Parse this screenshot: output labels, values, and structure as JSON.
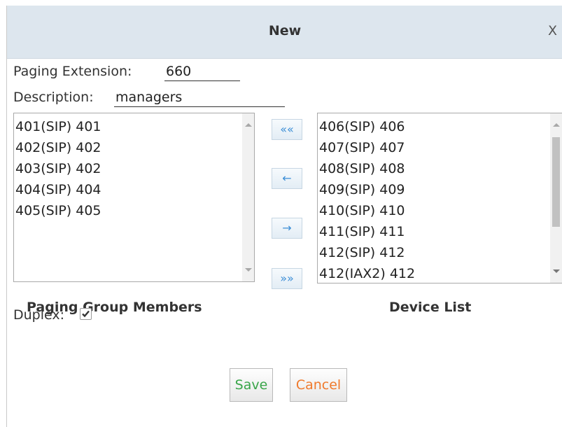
{
  "dialog": {
    "title": "New",
    "close_label": "X"
  },
  "form": {
    "paging_extension_label": "Paging Extension:",
    "paging_extension_value": "660",
    "description_label": "Description:",
    "description_value": "managers"
  },
  "members": {
    "caption": "Paging Group Members",
    "items": [
      "401(SIP) 401",
      "402(SIP) 402",
      "403(SIP) 402",
      "404(SIP) 404",
      "405(SIP) 405"
    ]
  },
  "devices": {
    "caption": "Device List",
    "items": [
      "406(SIP) 406",
      "407(SIP) 407",
      "408(SIP) 408",
      "409(SIP) 409",
      "410(SIP) 410",
      "411(SIP) 411",
      "412(SIP) 412",
      "412(IAX2) 412"
    ]
  },
  "transfer_buttons": {
    "all_left": "««",
    "one_left": "←",
    "one_right": "→",
    "all_right": "»»"
  },
  "duplex": {
    "label": "Duplex:",
    "checked": true
  },
  "actions": {
    "save_label": "Save",
    "cancel_label": "Cancel"
  },
  "colors": {
    "titlebar": "#dde6ee",
    "save_text": "#3aa64a",
    "cancel_text": "#f07a2c",
    "transfer_arrow": "#3b8ed6"
  }
}
